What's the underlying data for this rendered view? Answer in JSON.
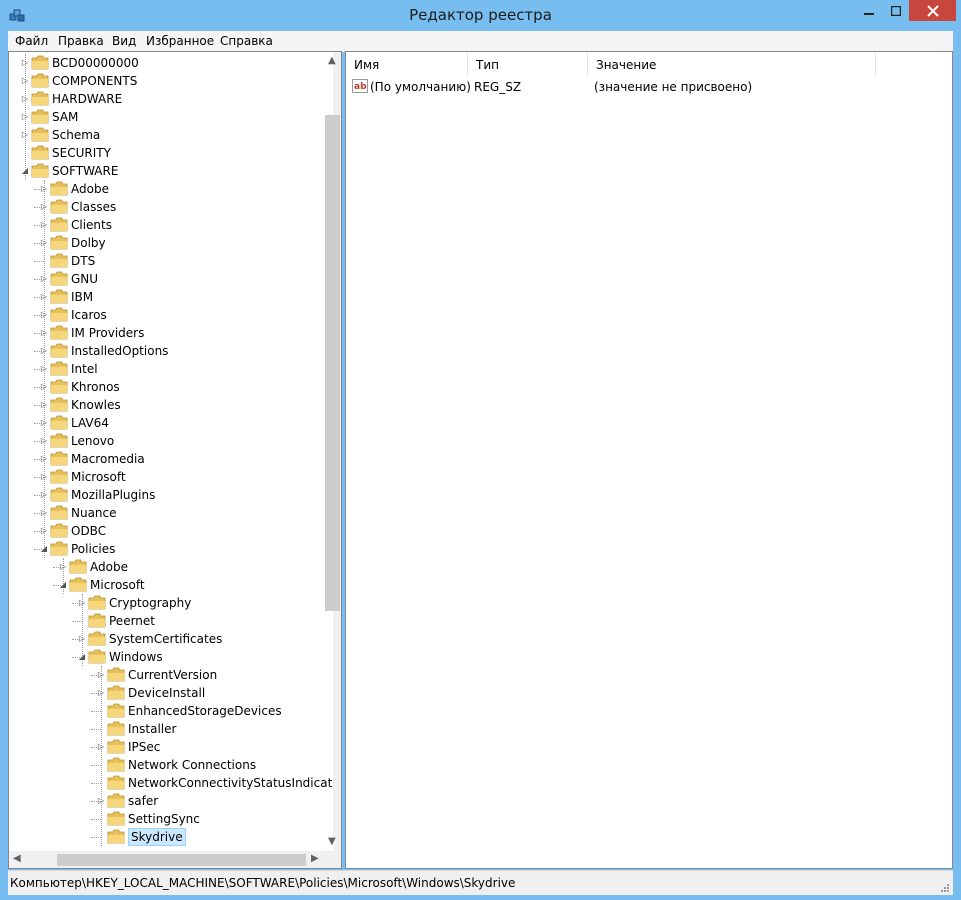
{
  "window": {
    "title": "Редактор реестра"
  },
  "menu": [
    "Файл",
    "Правка",
    "Вид",
    "Избранное",
    "Справка"
  ],
  "tree": [
    {
      "label": "BCD00000000",
      "level": 0,
      "arrow": "collapsed"
    },
    {
      "label": "COMPONENTS",
      "level": 0,
      "arrow": "collapsed"
    },
    {
      "label": "HARDWARE",
      "level": 0,
      "arrow": "collapsed"
    },
    {
      "label": "SAM",
      "level": 0,
      "arrow": "collapsed"
    },
    {
      "label": "Schema",
      "level": 0,
      "arrow": "collapsed"
    },
    {
      "label": "SECURITY",
      "level": 0,
      "arrow": "none"
    },
    {
      "label": "SOFTWARE",
      "level": 0,
      "arrow": "expanded"
    },
    {
      "label": "Adobe",
      "level": 1,
      "arrow": "collapsed"
    },
    {
      "label": "Classes",
      "level": 1,
      "arrow": "collapsed"
    },
    {
      "label": "Clients",
      "level": 1,
      "arrow": "collapsed"
    },
    {
      "label": "Dolby",
      "level": 1,
      "arrow": "collapsed"
    },
    {
      "label": "DTS",
      "level": 1,
      "arrow": "none"
    },
    {
      "label": "GNU",
      "level": 1,
      "arrow": "collapsed"
    },
    {
      "label": "IBM",
      "level": 1,
      "arrow": "collapsed"
    },
    {
      "label": "Icaros",
      "level": 1,
      "arrow": "collapsed"
    },
    {
      "label": "IM Providers",
      "level": 1,
      "arrow": "collapsed"
    },
    {
      "label": "InstalledOptions",
      "level": 1,
      "arrow": "collapsed"
    },
    {
      "label": "Intel",
      "level": 1,
      "arrow": "collapsed"
    },
    {
      "label": "Khronos",
      "level": 1,
      "arrow": "collapsed"
    },
    {
      "label": "Knowles",
      "level": 1,
      "arrow": "collapsed"
    },
    {
      "label": "LAV64",
      "level": 1,
      "arrow": "collapsed"
    },
    {
      "label": "Lenovo",
      "level": 1,
      "arrow": "collapsed"
    },
    {
      "label": "Macromedia",
      "level": 1,
      "arrow": "collapsed"
    },
    {
      "label": "Microsoft",
      "level": 1,
      "arrow": "collapsed"
    },
    {
      "label": "MozillaPlugins",
      "level": 1,
      "arrow": "collapsed"
    },
    {
      "label": "Nuance",
      "level": 1,
      "arrow": "collapsed"
    },
    {
      "label": "ODBC",
      "level": 1,
      "arrow": "collapsed"
    },
    {
      "label": "Policies",
      "level": 1,
      "arrow": "expanded"
    },
    {
      "label": "Adobe",
      "level": 2,
      "arrow": "collapsed"
    },
    {
      "label": "Microsoft",
      "level": 2,
      "arrow": "expanded"
    },
    {
      "label": "Cryptography",
      "level": 3,
      "arrow": "collapsed"
    },
    {
      "label": "Peernet",
      "level": 3,
      "arrow": "none"
    },
    {
      "label": "SystemCertificates",
      "level": 3,
      "arrow": "collapsed"
    },
    {
      "label": "Windows",
      "level": 3,
      "arrow": "expanded"
    },
    {
      "label": "CurrentVersion",
      "level": 4,
      "arrow": "collapsed"
    },
    {
      "label": "DeviceInstall",
      "level": 4,
      "arrow": "collapsed"
    },
    {
      "label": "EnhancedStorageDevices",
      "level": 4,
      "arrow": "none"
    },
    {
      "label": "Installer",
      "level": 4,
      "arrow": "none"
    },
    {
      "label": "IPSec",
      "level": 4,
      "arrow": "collapsed"
    },
    {
      "label": "Network Connections",
      "level": 4,
      "arrow": "none"
    },
    {
      "label": "NetworkConnectivityStatusIndicator",
      "level": 4,
      "arrow": "none"
    },
    {
      "label": "safer",
      "level": 4,
      "arrow": "collapsed"
    },
    {
      "label": "SettingSync",
      "level": 4,
      "arrow": "none"
    },
    {
      "label": "Skydrive",
      "level": 4,
      "arrow": "none",
      "selected": true
    }
  ],
  "list": {
    "columns": [
      "Имя",
      "Тип",
      "Значение"
    ],
    "rows": [
      {
        "name": "(По умолчанию)",
        "type": "REG_SZ",
        "value": "(значение не присвоено)"
      }
    ]
  },
  "status": {
    "path": "Компьютер\\HKEY_LOCAL_MACHINE\\SOFTWARE\\Policies\\Microsoft\\Windows\\Skydrive"
  },
  "colors": {
    "title_bg": "#78bdf0",
    "close_bg": "#c7463d",
    "selection": "#cce8ff",
    "folder": "#e8c15a"
  }
}
